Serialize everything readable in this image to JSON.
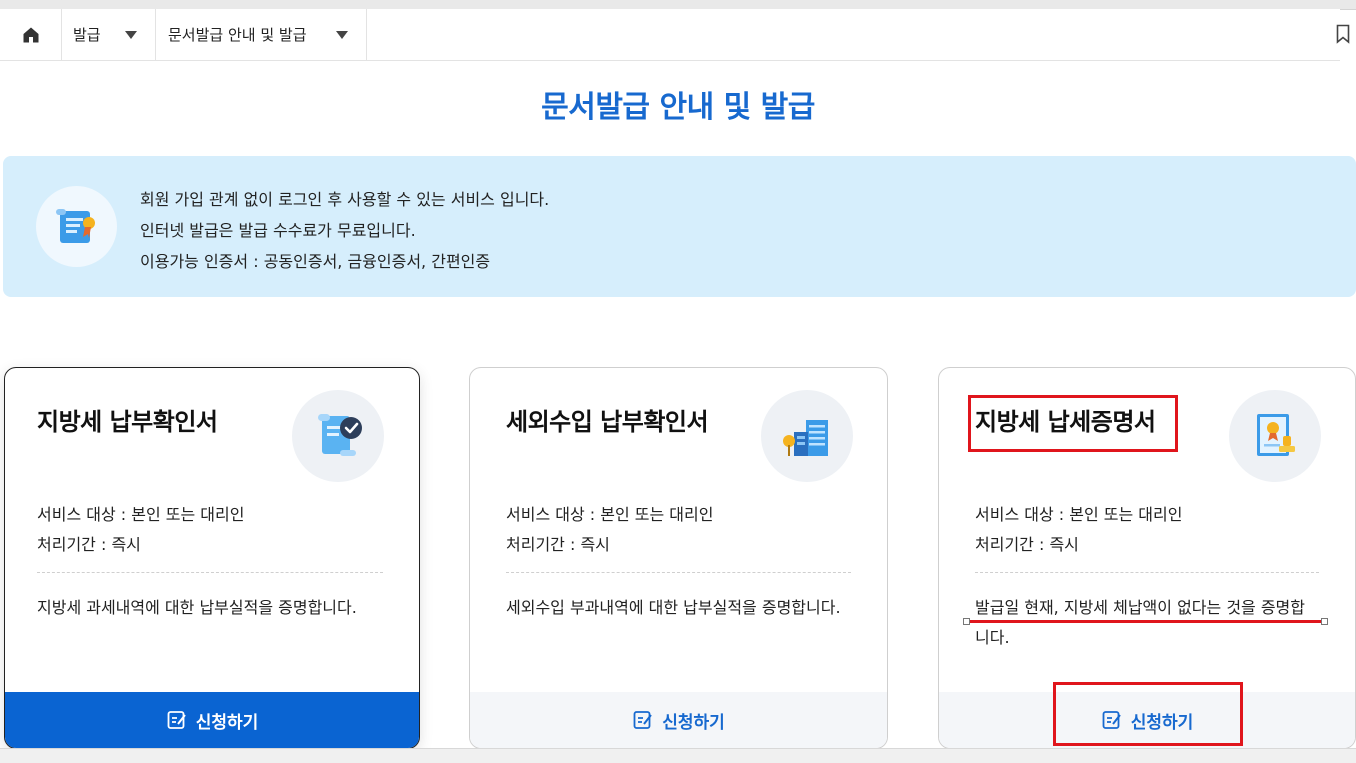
{
  "breadcrumb": {
    "home_icon": "home-icon",
    "items": [
      {
        "label": "발급"
      },
      {
        "label": "문서발급 안내 및 발급"
      }
    ]
  },
  "page": {
    "title": "문서발급 안내 및 발급"
  },
  "notice": {
    "icon": "certificate-scroll-icon",
    "lines": [
      "회원 가입 관계 없이 로그인 후 사용할 수 있는 서비스 입니다.",
      "인터넷 발급은 발급 수수료가 무료입니다.",
      "이용가능 인증서 : 공동인증서, 금융인증서, 간편인증"
    ]
  },
  "cards": [
    {
      "title": "지방세 납부확인서",
      "icon": "document-check-icon",
      "target": "서비스 대상 : 본인 또는 대리인",
      "period": "처리기간 : 즉시",
      "description": "지방세 과세내역에 대한 납부실적을 증명합니다.",
      "apply_label": "신청하기"
    },
    {
      "title": "세외수입 납부확인서",
      "icon": "building-icon",
      "target": "서비스 대상 : 본인 또는 대리인",
      "period": "처리기간 : 즉시",
      "description": "세외수입 부과내역에 대한 납부실적을 증명합니다.",
      "apply_label": "신청하기"
    },
    {
      "title": "지방세 납세증명서",
      "icon": "certificate-stamp-icon",
      "target": "서비스 대상 : 본인 또는 대리인",
      "period": "처리기간 : 즉시",
      "description": "발급일 현재, 지방세 체납액이 없다는 것을 증명합니다.",
      "apply_label": "신청하기"
    }
  ],
  "colors": {
    "accent": "#1769cf",
    "notice_bg": "#d6eefc",
    "active_button": "#0a64d2",
    "highlight": "#e0151c"
  }
}
